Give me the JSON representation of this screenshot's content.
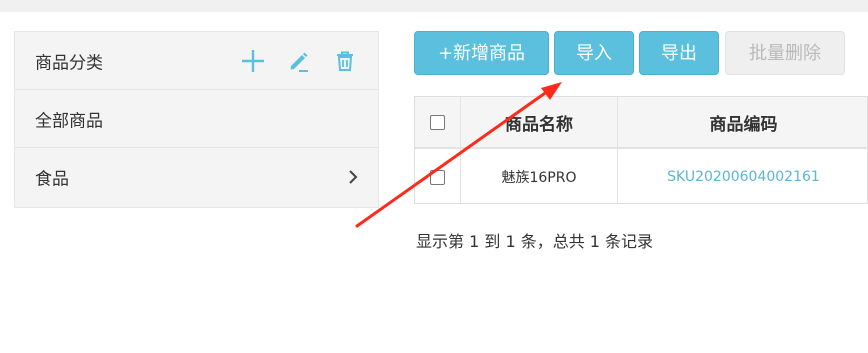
{
  "categories": {
    "header_label": "商品分类",
    "items": [
      {
        "label": "全部商品"
      },
      {
        "label": "食品"
      }
    ]
  },
  "toolbar": {
    "add_label": "+新增商品",
    "import_label": "导入",
    "export_label": "导出",
    "batch_delete_label": "批量删除"
  },
  "table": {
    "columns": [
      "商品名称",
      "商品编码"
    ],
    "rows": [
      {
        "name": "魅族16PRO",
        "code": "SKU20200604002161"
      }
    ]
  },
  "pager": {
    "summary": "显示第 1 到 1 条，总共 1 条记录"
  },
  "colors": {
    "primary": "#5bc0de",
    "link": "#5bb5d6",
    "annotation_arrow": "#ff2a1a"
  }
}
